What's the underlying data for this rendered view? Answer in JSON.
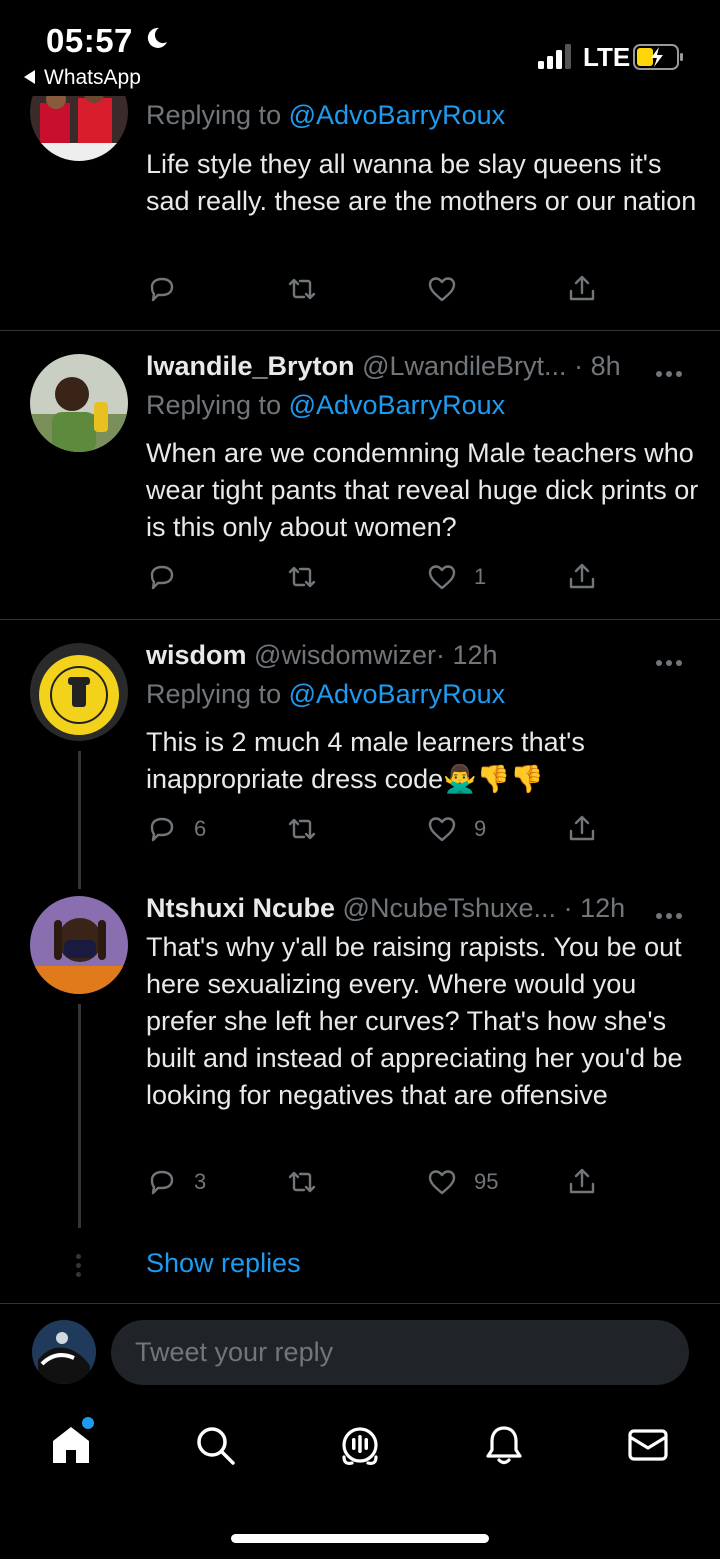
{
  "status_bar": {
    "time": "05:57",
    "back_app": "WhatsApp",
    "network": "LTE"
  },
  "tweets": [
    {
      "reply_prefix": "Replying to",
      "reply_mention": "@AdvoBarryRoux",
      "text": "Life style they all wanna be slay queens it's sad really. these are the mothers or our nation",
      "replies": "",
      "likes": ""
    },
    {
      "name": "lwandile_Bryton",
      "handle": "@LwandileBryt...",
      "time": "· 8h",
      "reply_prefix": "Replying to",
      "reply_mention": "@AdvoBarryRoux",
      "text": "When are we condemning Male teachers who wear tight pants that reveal huge dick prints or is this only about women?",
      "replies": "",
      "likes": "1"
    },
    {
      "name": "wisdom",
      "handle": "@wisdomwizer",
      "time": "· 12h",
      "reply_prefix": "Replying to",
      "reply_mention": "@AdvoBarryRoux",
      "text": "This is 2 much 4 male learners that's inappropriate dress code🙅‍♂️👎👎",
      "replies": "6",
      "likes": "9"
    },
    {
      "name": "Ntshuxi Ncube",
      "handle": "@NcubeTshuxe...",
      "time": "· 12h",
      "text": "That's why y'all be raising rapists. You be out here sexualizing every. Where would you prefer she left her curves? That's how she's built and instead of appreciating her you'd be looking for negatives that are offensive",
      "replies": "3",
      "likes": "95"
    }
  ],
  "show_replies": "Show replies",
  "composer": {
    "placeholder": "Tweet your reply"
  },
  "colors": {
    "accent": "#1d9bf0",
    "muted": "#71767b",
    "text": "#e7e9ea",
    "background": "#000000"
  },
  "icons": [
    "reply-icon",
    "retweet-icon",
    "like-icon",
    "share-icon",
    "home-icon",
    "search-icon",
    "spaces-icon",
    "notifications-icon",
    "messages-icon"
  ]
}
